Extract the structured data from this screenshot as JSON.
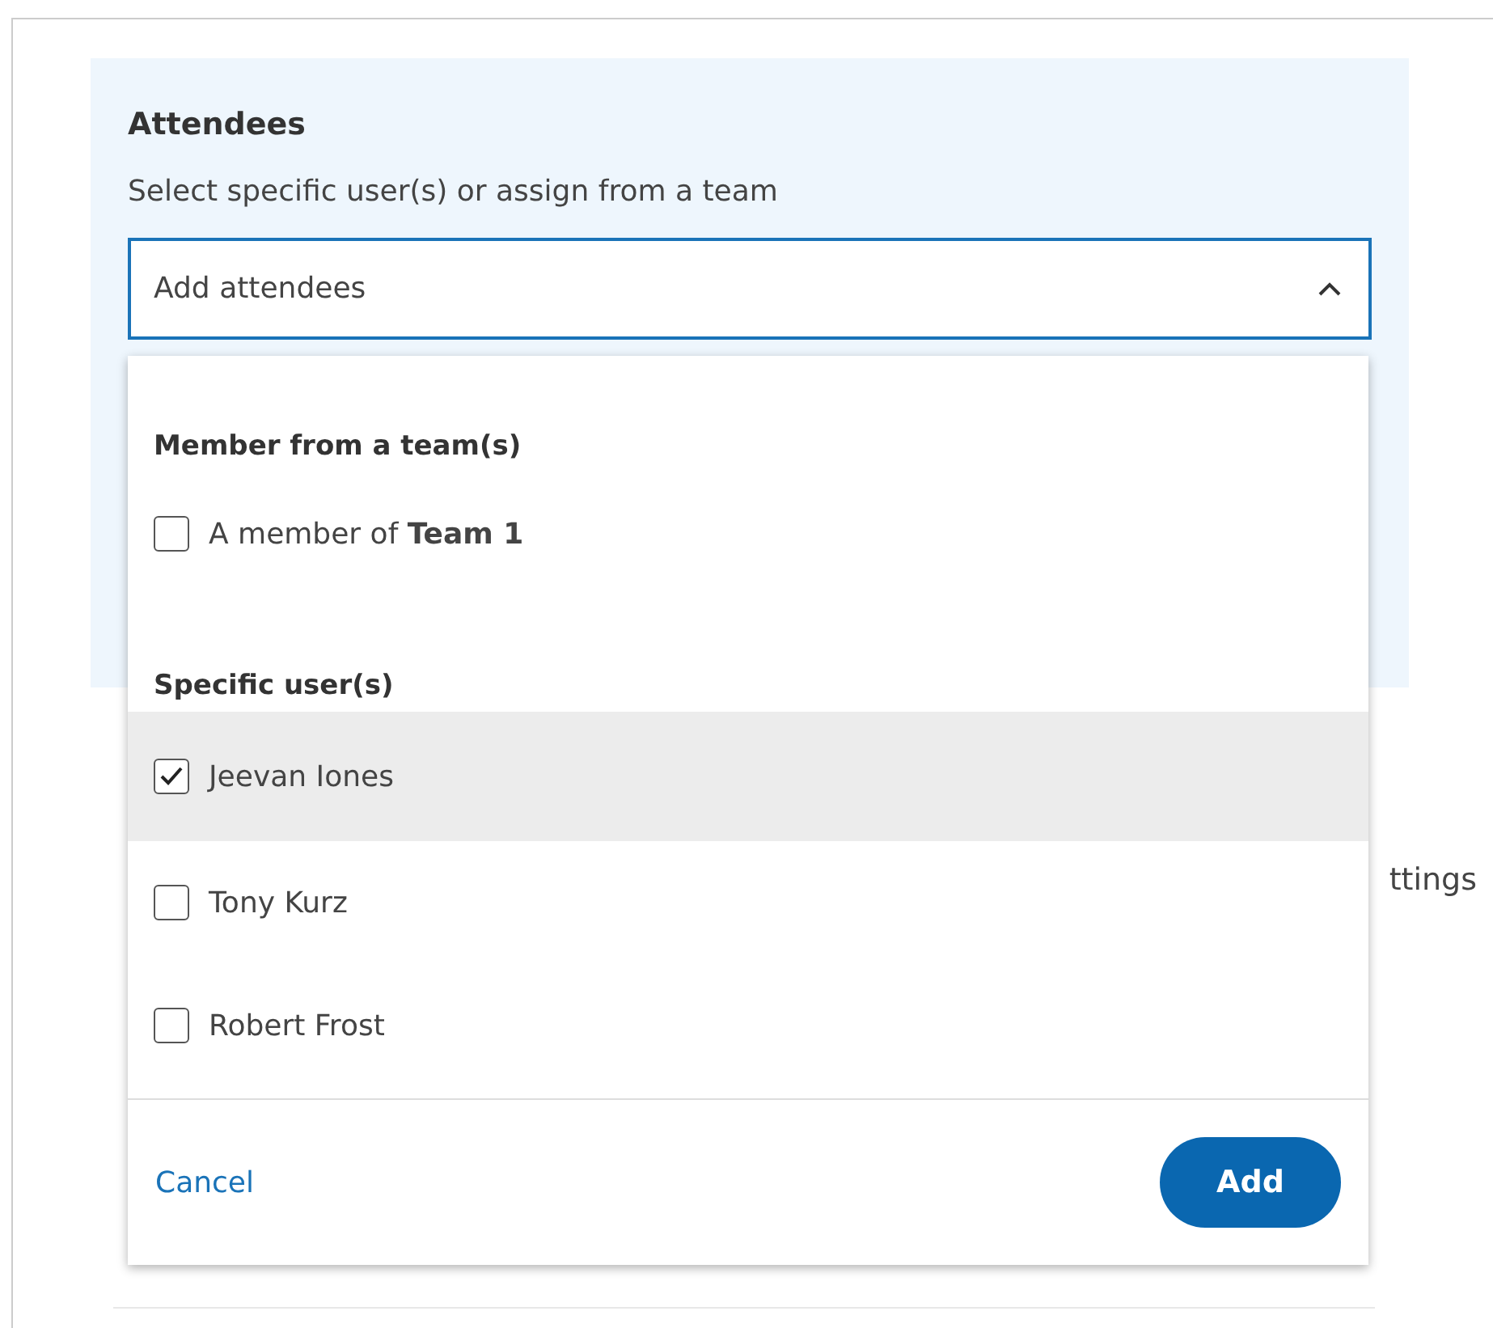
{
  "field": {
    "label": "Attendees",
    "hint": "Select specific user(s) or assign from a team",
    "placeholder": "Add attendees",
    "expanded": true
  },
  "dropdown": {
    "groups": [
      {
        "heading": "Member from a team(s)",
        "options": [
          {
            "label": "A member of **Team 1**",
            "checked": false,
            "selected": false
          }
        ]
      },
      {
        "heading": "Specific user(s)",
        "options": [
          {
            "label": "Jeevan Iones",
            "checked": true,
            "selected": true
          },
          {
            "label": "Tony Kurz",
            "checked": false,
            "selected": false
          },
          {
            "label": "Robert Frost",
            "checked": false,
            "selected": false
          }
        ]
      }
    ],
    "buttons": [
      {
        "label": "Cancel",
        "kind": "link"
      },
      {
        "label": "Add",
        "kind": "primary"
      }
    ]
  },
  "background_text": "ttings"
}
